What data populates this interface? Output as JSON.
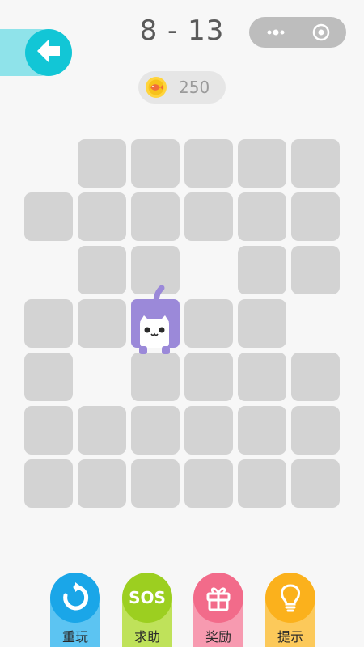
{
  "header": {
    "level": "8 - 13",
    "coins": "250"
  },
  "icons": {
    "back": "back-arrow-icon",
    "more": "more-dots-icon",
    "close": "target-circle-icon",
    "coin": "fish-coin-icon",
    "cat": "purple-cat-character"
  },
  "tools": [
    {
      "label": "重玩",
      "icon": "replay-icon",
      "head": "#1aa6e8",
      "stem": "#5cc4f2"
    },
    {
      "label": "求助",
      "icon": "sos-icon",
      "head": "#9ccf20",
      "stem": "#bfe25a",
      "sos_text": "SOS"
    },
    {
      "label": "奖励",
      "icon": "gift-icon",
      "head": "#f26b8a",
      "stem": "#f79ab0"
    },
    {
      "label": "提示",
      "icon": "lightbulb-icon",
      "head": "#fbb11c",
      "stem": "#fcc95a"
    }
  ],
  "colors": {
    "background": "#f7f7f7",
    "tile": "#d3d3d3",
    "cat": "#9b89d9"
  }
}
